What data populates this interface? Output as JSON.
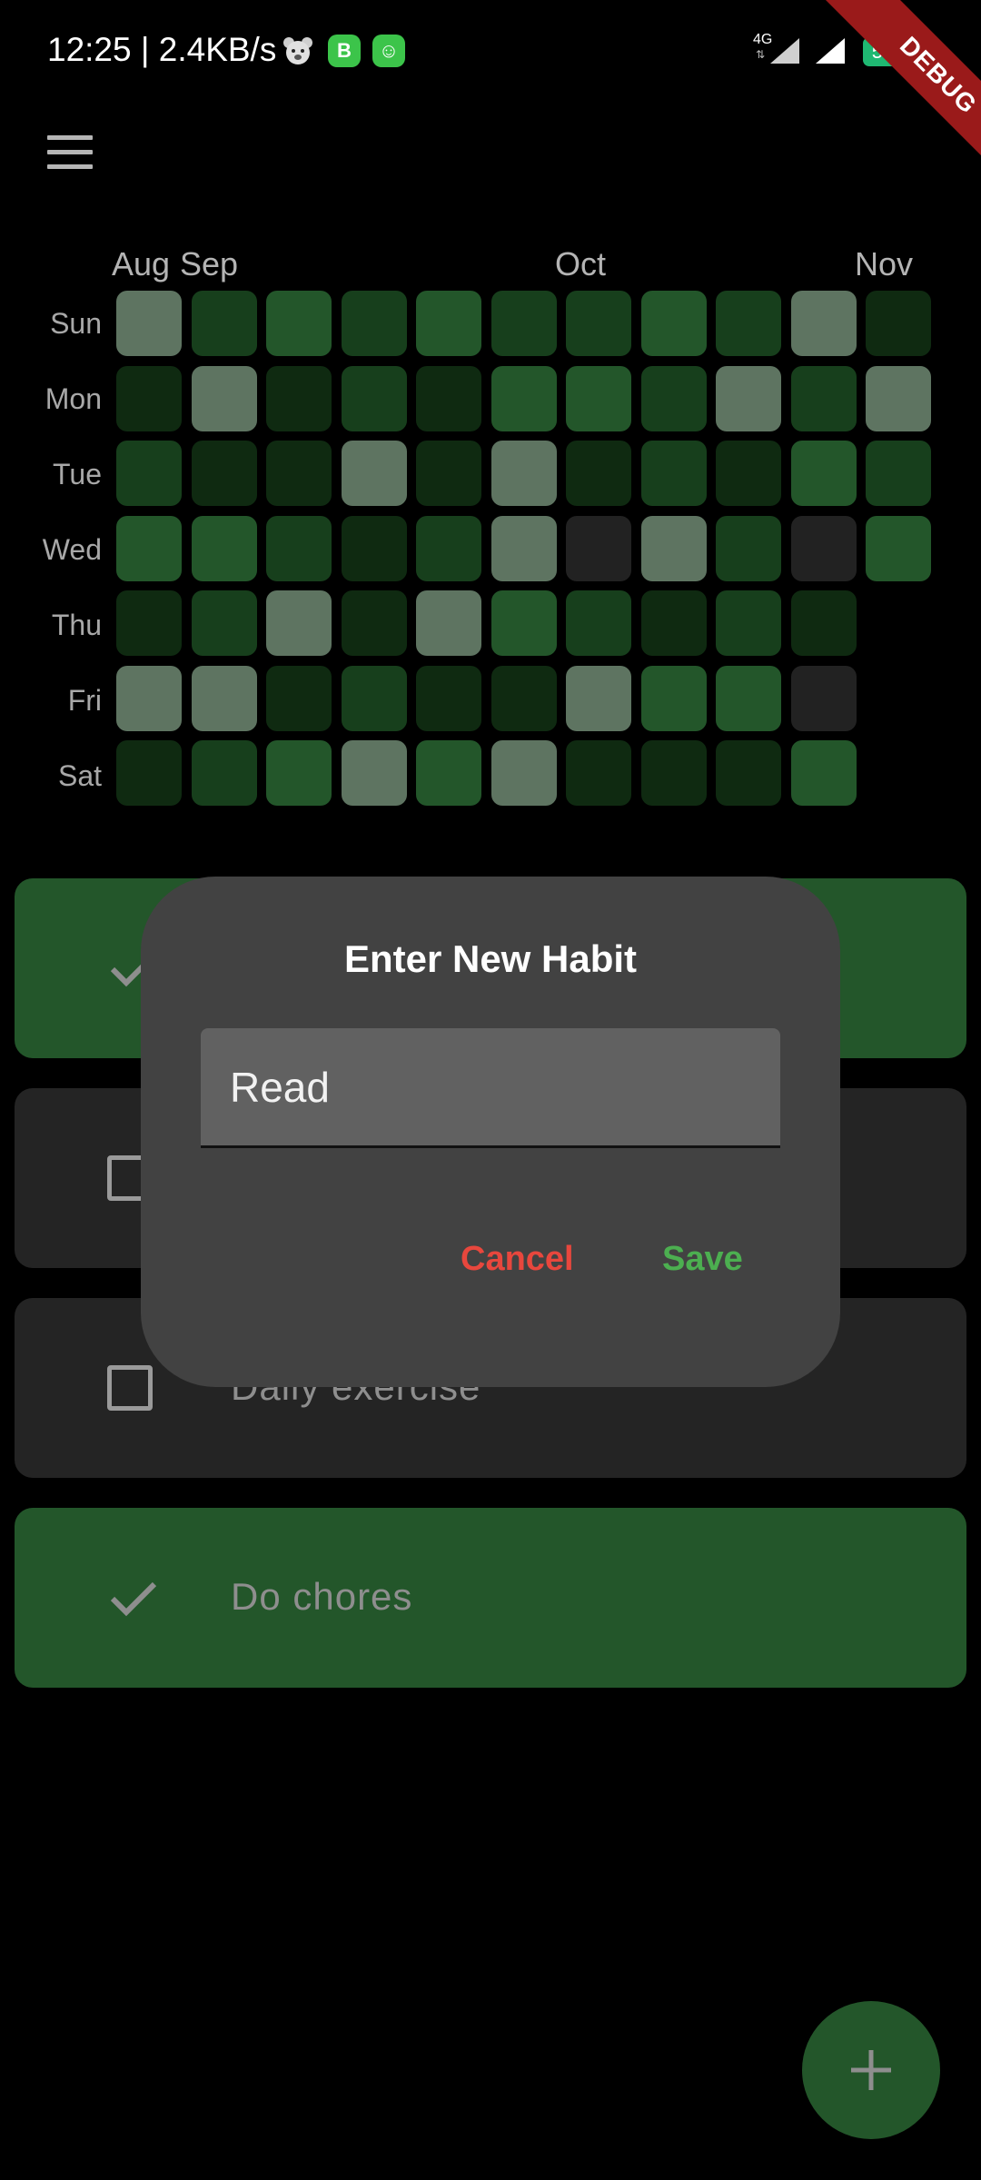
{
  "status_bar": {
    "time_speed": "12:25 | 2.4KB/s",
    "network": "4G",
    "battery": "53",
    "icons": [
      "bear-icon",
      "chat-b-icon",
      "android-icon",
      "signal-icon",
      "signal-icon",
      "battery-icon"
    ],
    "debug_banner": "DEBUG"
  },
  "app_bar": {
    "menu_icon": "menu-icon"
  },
  "heatmap": {
    "months": [
      "Aug",
      "Sep",
      "Oct",
      "Nov"
    ],
    "days": [
      "Sun",
      "Mon",
      "Tue",
      "Wed",
      "Thu",
      "Fri",
      "Sat"
    ],
    "levels_legend": {
      "0": "#222222",
      "1": "#0f2a11",
      "2": "#173f1c",
      "3": "#23562a",
      "4": "#5e7461"
    },
    "grid_by_week": [
      [
        4,
        1,
        2,
        3,
        1,
        4,
        1
      ],
      [
        2,
        4,
        1,
        3,
        2,
        4,
        2
      ],
      [
        3,
        1,
        1,
        2,
        4,
        1,
        3
      ],
      [
        2,
        2,
        4,
        1,
        1,
        2,
        4
      ],
      [
        3,
        1,
        1,
        2,
        4,
        1,
        3
      ],
      [
        2,
        3,
        4,
        4,
        3,
        1,
        4
      ],
      [
        2,
        3,
        1,
        0,
        2,
        4,
        1
      ],
      [
        3,
        2,
        2,
        4,
        1,
        3,
        1
      ],
      [
        2,
        4,
        1,
        2,
        2,
        3,
        1
      ],
      [
        4,
        2,
        3,
        0,
        1,
        0,
        3
      ],
      [
        1,
        4,
        2,
        3
      ]
    ]
  },
  "habits": [
    {
      "name": "",
      "done": true
    },
    {
      "name": "",
      "done": false
    },
    {
      "name": "Daily exercise",
      "done": false
    },
    {
      "name": "Do chores",
      "done": true
    }
  ],
  "dialog": {
    "title": "Enter New Habit",
    "input_value": "Read",
    "cancel_label": "Cancel",
    "save_label": "Save"
  },
  "fab": {
    "icon": "plus-icon"
  },
  "colors": {
    "background": "#000000",
    "tile_done": "#23562a",
    "tile_todo": "#242424",
    "dialog": "#424242",
    "cancel": "#e8473d",
    "save": "#4caf50"
  }
}
